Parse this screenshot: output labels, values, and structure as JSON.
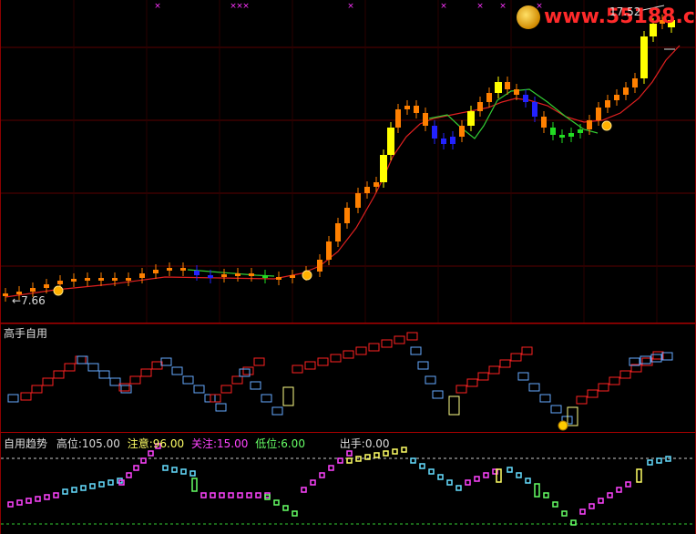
{
  "main": {
    "high_price_label": "17.52",
    "low_price_label": "7.66",
    "watermark": "www.55188.com",
    "colors": {
      "bg": "#000000",
      "border": "#8b0000",
      "grid": "#5a0000",
      "ma_red": "#e02020",
      "ma_green": "#33cc33",
      "candle_yellow": "#ffff00",
      "candle_orange": "#ff8000",
      "candle_blue": "#2222ff",
      "candle_green": "#22dd22",
      "candle_cyan": "#00aaff"
    },
    "icons": [
      "gold-ball-icon",
      "magenta-x-marker-icon"
    ]
  },
  "mid_panel": {
    "title": "高手自用"
  },
  "low_panel": {
    "title": "自用趋势",
    "high_label": "高位:",
    "high_value": "105.00",
    "attention_label": "注意:",
    "attention_value": "96.00",
    "focus_label": "关注:",
    "focus_value": "15.00",
    "low_label": "低位:",
    "low_value": "6.00",
    "sell_label": "出手:",
    "sell_value": "0.00",
    "colors": {
      "high": "#dddddd",
      "attention": "#ffff66",
      "focus": "#ff44ff",
      "low": "#66ff66",
      "sell": "#dddddd"
    }
  }
}
